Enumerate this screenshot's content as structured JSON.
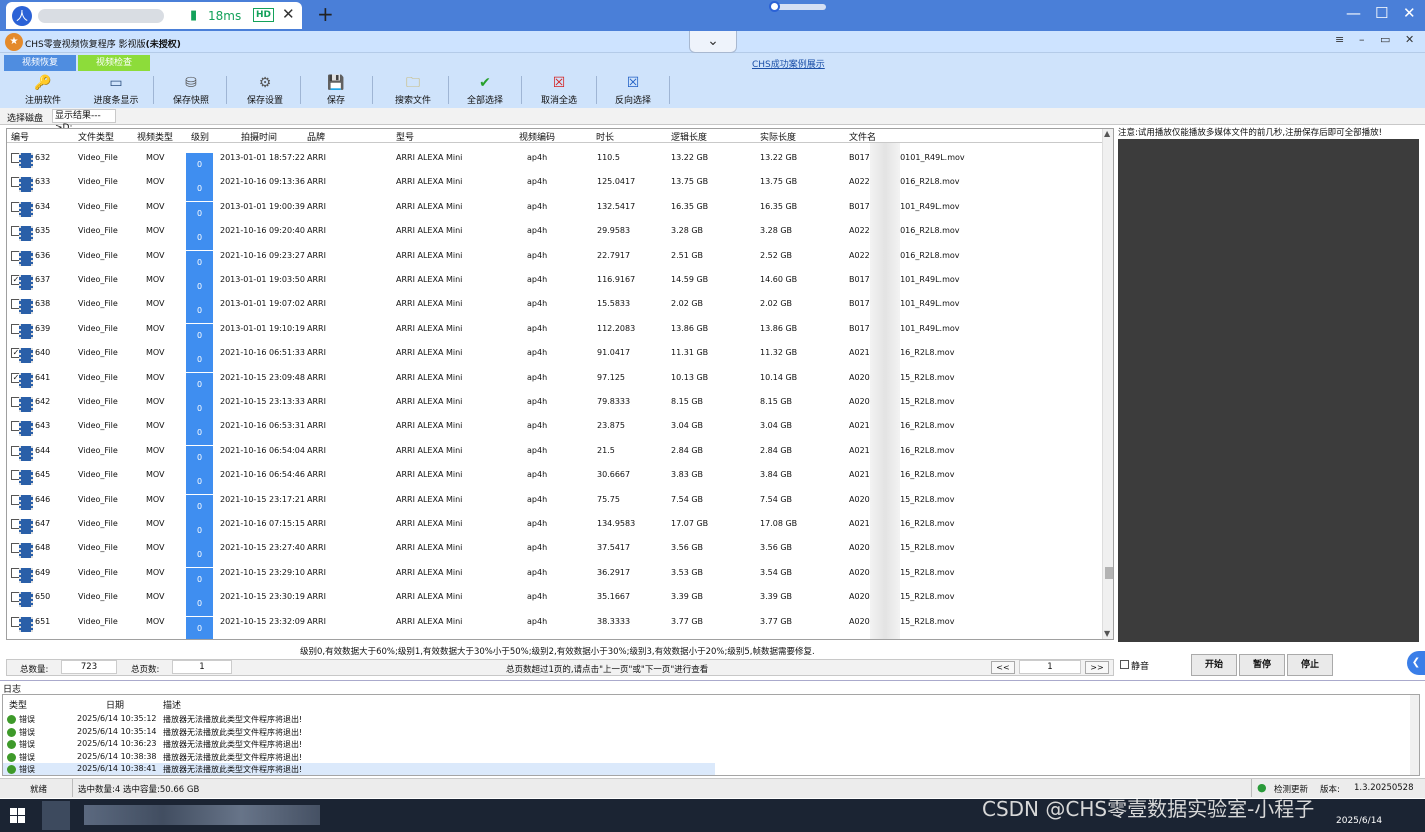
{
  "remote": {
    "avatar_label": "人",
    "ping": "18ms",
    "hd": "HD",
    "close": "✕",
    "new_tab": "+",
    "minimize": "—",
    "maximize": "☐",
    "close_window": "✕"
  },
  "app": {
    "title": "CHS零壹视频恢复程序 影视版",
    "title_suffix": "(未授权)",
    "link": "CHS成功案例展示",
    "dropdown_glyph": "⌄",
    "tabs": [
      "视频恢复",
      "视频检查"
    ],
    "toolbar": [
      {
        "label": "注册软件",
        "icon": "key-icon",
        "glyph": "🔑"
      },
      {
        "label": "进度条显示",
        "icon": "progress-icon",
        "glyph": "▭"
      },
      {
        "label": "保存快照",
        "icon": "snapshot-icon",
        "glyph": "⛁"
      },
      {
        "label": "保存设置",
        "icon": "settings-save-icon",
        "glyph": "⚙"
      },
      {
        "label": "保存",
        "icon": "save-icon",
        "glyph": "💾"
      },
      {
        "label": "搜索文件",
        "icon": "search-file-icon",
        "glyph": "🗀"
      },
      {
        "label": "全部选择",
        "icon": "check-icon",
        "glyph": "✔"
      },
      {
        "label": "取消全选",
        "icon": "uncheck-icon",
        "glyph": "☒"
      },
      {
        "label": "反向选择",
        "icon": "invert-icon",
        "glyph": "☒"
      }
    ]
  },
  "path": {
    "label": "选择磁盘",
    "result": "显示结果--->D:"
  },
  "grid": {
    "columns": [
      "编号",
      "文件类型",
      "视频类型",
      "级别",
      "拍摄时间",
      "品牌",
      "型号",
      "视频编码",
      "时长",
      "逻辑长度",
      "实际长度",
      "文件名"
    ],
    "rows": [
      {
        "id": "632",
        "checked": false,
        "type": "Video_File",
        "vtype": "MOV",
        "level": "0",
        "time": "2013-01-01 18:57:22",
        "brand": "ARRI",
        "model": "ARRI ALEXA Mini",
        "codec": "ap4h",
        "duration": "110.5",
        "logical": "13.22 GB",
        "actual": "13.22 GB",
        "name_a": "B017C",
        "name_b": "30101_R49L.mov"
      },
      {
        "id": "633",
        "checked": false,
        "type": "Video_File",
        "vtype": "MOV",
        "level": "0",
        "time": "2021-10-16 09:13:36",
        "brand": "ARRI",
        "model": "ARRI ALEXA Mini",
        "codec": "ap4h",
        "duration": "125.0417",
        "logical": "13.75 GB",
        "actual": "13.75 GB",
        "name_a": "A022",
        "name_b": "1016_R2L8.mov"
      },
      {
        "id": "634",
        "checked": false,
        "type": "Video_File",
        "vtype": "MOV",
        "level": "0",
        "time": "2013-01-01 19:00:39",
        "brand": "ARRI",
        "model": "ARRI ALEXA Mini",
        "codec": "ap4h",
        "duration": "132.5417",
        "logical": "16.35 GB",
        "actual": "16.35 GB",
        "name_a": "B017",
        "name_b": "0101_R49L.mov"
      },
      {
        "id": "635",
        "checked": false,
        "type": "Video_File",
        "vtype": "MOV",
        "level": "0",
        "time": "2021-10-16 09:20:40",
        "brand": "ARRI",
        "model": "ARRI ALEXA Mini",
        "codec": "ap4h",
        "duration": "29.9583",
        "logical": "3.28 GB",
        "actual": "3.28 GB",
        "name_a": "A022",
        "name_b": "1016_R2L8.mov"
      },
      {
        "id": "636",
        "checked": false,
        "type": "Video_File",
        "vtype": "MOV",
        "level": "0",
        "time": "2021-10-16 09:23:27",
        "brand": "ARRI",
        "model": "ARRI ALEXA Mini",
        "codec": "ap4h",
        "duration": "22.7917",
        "logical": "2.51 GB",
        "actual": "2.52 GB",
        "name_a": "A022",
        "name_b": "1016_R2L8.mov"
      },
      {
        "id": "637",
        "checked": true,
        "type": "Video_File",
        "vtype": "MOV",
        "level": "0",
        "time": "2013-01-01 19:03:50",
        "brand": "ARRI",
        "model": "ARRI ALEXA Mini",
        "codec": "ap4h",
        "duration": "116.9167",
        "logical": "14.59 GB",
        "actual": "14.60 GB",
        "name_a": "B017",
        "name_b": "0101_R49L.mov"
      },
      {
        "id": "638",
        "checked": false,
        "type": "Video_File",
        "vtype": "MOV",
        "level": "0",
        "time": "2013-01-01 19:07:02",
        "brand": "ARRI",
        "model": "ARRI ALEXA Mini",
        "codec": "ap4h",
        "duration": "15.5833",
        "logical": "2.02 GB",
        "actual": "2.02 GB",
        "name_a": "B017",
        "name_b": "0101_R49L.mov"
      },
      {
        "id": "639",
        "checked": false,
        "type": "Video_File",
        "vtype": "MOV",
        "level": "0",
        "time": "2013-01-01 19:10:19",
        "brand": "ARRI",
        "model": "ARRI ALEXA Mini",
        "codec": "ap4h",
        "duration": "112.2083",
        "logical": "13.86 GB",
        "actual": "13.86 GB",
        "name_a": "B017",
        "name_b": "0101_R49L.mov"
      },
      {
        "id": "640",
        "checked": true,
        "type": "Video_File",
        "vtype": "MOV",
        "level": "0",
        "time": "2021-10-16 06:51:33",
        "brand": "ARRI",
        "model": "ARRI ALEXA Mini",
        "codec": "ap4h",
        "duration": "91.0417",
        "logical": "11.31 GB",
        "actual": "11.32 GB",
        "name_a": "A021",
        "name_b": "016_R2L8.mov"
      },
      {
        "id": "641",
        "checked": true,
        "type": "Video_File",
        "vtype": "MOV",
        "level": "0",
        "time": "2021-10-15 23:09:48",
        "brand": "ARRI",
        "model": "ARRI ALEXA Mini",
        "codec": "ap4h",
        "duration": "97.125",
        "logical": "10.13 GB",
        "actual": "10.14 GB",
        "name_a": "A020",
        "name_b": "015_R2L8.mov"
      },
      {
        "id": "642",
        "checked": false,
        "type": "Video_File",
        "vtype": "MOV",
        "level": "0",
        "time": "2021-10-15 23:13:33",
        "brand": "ARRI",
        "model": "ARRI ALEXA Mini",
        "codec": "ap4h",
        "duration": "79.8333",
        "logical": "8.15 GB",
        "actual": "8.15 GB",
        "name_a": "A020",
        "name_b": "015_R2L8.mov"
      },
      {
        "id": "643",
        "checked": false,
        "type": "Video_File",
        "vtype": "MOV",
        "level": "0",
        "time": "2021-10-16 06:53:31",
        "brand": "ARRI",
        "model": "ARRI ALEXA Mini",
        "codec": "ap4h",
        "duration": "23.875",
        "logical": "3.04 GB",
        "actual": "3.04 GB",
        "name_a": "A021",
        "name_b": "016_R2L8.mov"
      },
      {
        "id": "644",
        "checked": false,
        "type": "Video_File",
        "vtype": "MOV",
        "level": "0",
        "time": "2021-10-16 06:54:04",
        "brand": "ARRI",
        "model": "ARRI ALEXA Mini",
        "codec": "ap4h",
        "duration": "21.5",
        "logical": "2.84 GB",
        "actual": "2.84 GB",
        "name_a": "A021",
        "name_b": "016_R2L8.mov"
      },
      {
        "id": "645",
        "checked": false,
        "type": "Video_File",
        "vtype": "MOV",
        "level": "0",
        "time": "2021-10-16 06:54:46",
        "brand": "ARRI",
        "model": "ARRI ALEXA Mini",
        "codec": "ap4h",
        "duration": "30.6667",
        "logical": "3.83 GB",
        "actual": "3.84 GB",
        "name_a": "A021",
        "name_b": "016_R2L8.mov"
      },
      {
        "id": "646",
        "checked": false,
        "type": "Video_File",
        "vtype": "MOV",
        "level": "0",
        "time": "2021-10-15 23:17:21",
        "brand": "ARRI",
        "model": "ARRI ALEXA Mini",
        "codec": "ap4h",
        "duration": "75.75",
        "logical": "7.54 GB",
        "actual": "7.54 GB",
        "name_a": "A020",
        "name_b": "015_R2L8.mov"
      },
      {
        "id": "647",
        "checked": false,
        "type": "Video_File",
        "vtype": "MOV",
        "level": "0",
        "time": "2021-10-16 07:15:15",
        "brand": "ARRI",
        "model": "ARRI ALEXA Mini",
        "codec": "ap4h",
        "duration": "134.9583",
        "logical": "17.07 GB",
        "actual": "17.08 GB",
        "name_a": "A021",
        "name_b": "016_R2L8.mov"
      },
      {
        "id": "648",
        "checked": false,
        "type": "Video_File",
        "vtype": "MOV",
        "level": "0",
        "time": "2021-10-15 23:27:40",
        "brand": "ARRI",
        "model": "ARRI ALEXA Mini",
        "codec": "ap4h",
        "duration": "37.5417",
        "logical": "3.56 GB",
        "actual": "3.56 GB",
        "name_a": "A020",
        "name_b": "015_R2L8.mov"
      },
      {
        "id": "649",
        "checked": false,
        "type": "Video_File",
        "vtype": "MOV",
        "level": "0",
        "time": "2021-10-15 23:29:10",
        "brand": "ARRI",
        "model": "ARRI ALEXA Mini",
        "codec": "ap4h",
        "duration": "36.2917",
        "logical": "3.53 GB",
        "actual": "3.54 GB",
        "name_a": "A020",
        "name_b": "015_R2L8.mov"
      },
      {
        "id": "650",
        "checked": false,
        "type": "Video_File",
        "vtype": "MOV",
        "level": "0",
        "time": "2021-10-15 23:30:19",
        "brand": "ARRI",
        "model": "ARRI ALEXA Mini",
        "codec": "ap4h",
        "duration": "35.1667",
        "logical": "3.39 GB",
        "actual": "3.39 GB",
        "name_a": "A020",
        "name_b": "015_R2L8.mov"
      },
      {
        "id": "651",
        "checked": false,
        "type": "Video_File",
        "vtype": "MOV",
        "level": "0",
        "time": "2021-10-15 23:32:09",
        "brand": "ARRI",
        "model": "ARRI ALEXA Mini",
        "codec": "ap4h",
        "duration": "38.3333",
        "logical": "3.77 GB",
        "actual": "3.77 GB",
        "name_a": "A020",
        "name_b": "015_R2L8.mov"
      }
    ],
    "legend": "级别0,有效数据大于60%;级别1,有效数据大于30%小于50%;级别2,有效数据小于30%;级别3,有效数据小于20%;级别5,帧数据需要修复."
  },
  "status": {
    "total_label": "总数量:",
    "total_value": "723",
    "pages_label": "总页数:",
    "pages_value": "1",
    "hint": "总页数超过1页的,请点击\"上一页\"或\"下一页\"进行查看",
    "prev": "<<",
    "page": "1",
    "next": ">>"
  },
  "preview": {
    "note": "注意:试用播放仅能播放多媒体文件的前几秒,注册保存后即可全部播放!",
    "mute": "静音",
    "start": "开始",
    "pause": "暂停",
    "stop": "停止"
  },
  "log": {
    "label": "日志",
    "columns": [
      "类型",
      "日期",
      "描述"
    ],
    "rows": [
      {
        "type": "错误",
        "date": "2025/6/14 10:35:12",
        "desc": "播放器无法播放此类型文件程序将退出!"
      },
      {
        "type": "错误",
        "date": "2025/6/14 10:35:14",
        "desc": "播放器无法播放此类型文件程序将退出!"
      },
      {
        "type": "错误",
        "date": "2025/6/14 10:36:23",
        "desc": "播放器无法播放此类型文件程序将退出!"
      },
      {
        "type": "错误",
        "date": "2025/6/14 10:38:38",
        "desc": "播放器无法播放此类型文件程序将退出!"
      },
      {
        "type": "错误",
        "date": "2025/6/14 10:38:41",
        "desc": "播放器无法播放此类型文件程序将退出!"
      }
    ]
  },
  "statusbar": {
    "ready": "就绪",
    "selection": "选中数量:4 选中容量:50.66 GB",
    "update": "检测更新",
    "version_label": "版本:",
    "version": "1.3.20250528"
  },
  "taskbar": {
    "watermark": "CSDN @CHS零壹数据实验室-小程子",
    "date": "2025/6/14"
  },
  "colors": {
    "remote_bar": "#4a7fd8",
    "ribbon": "#cfe3fb",
    "level_cell": "#3f8ef0",
    "tab_check": "#8ddc3a",
    "preview_bg": "#3c3c3c"
  }
}
